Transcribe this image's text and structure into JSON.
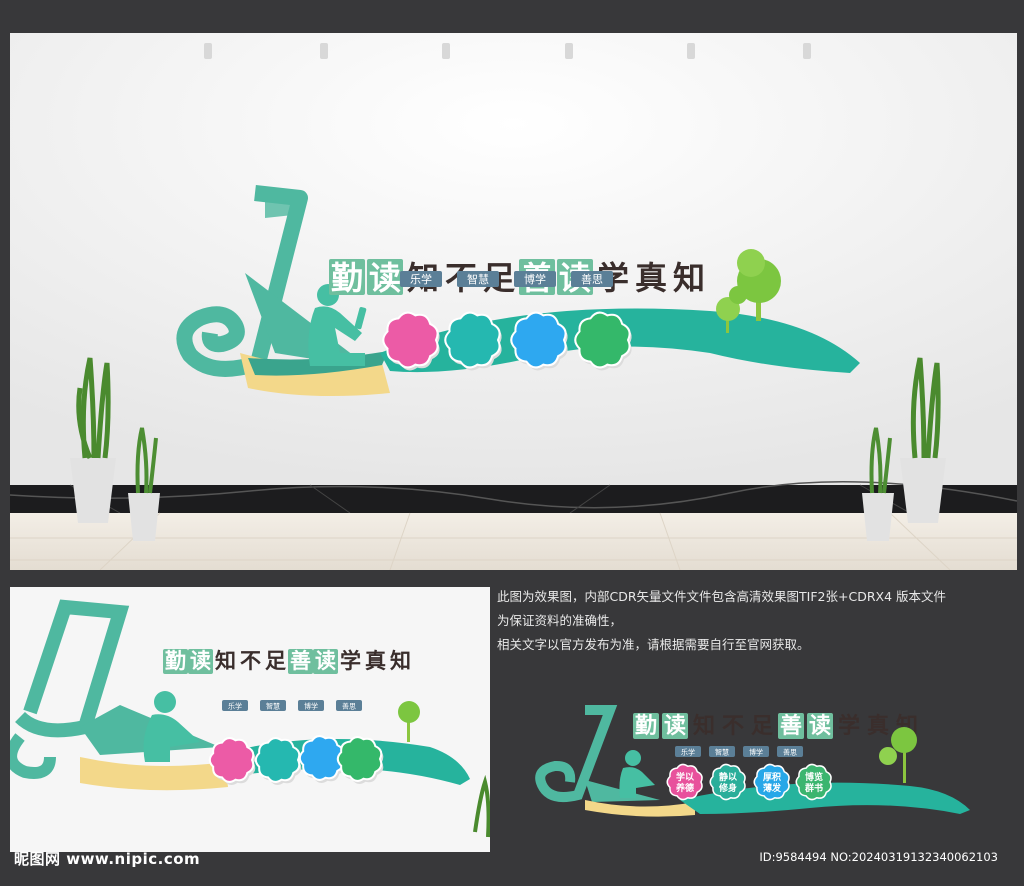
{
  "slogan": {
    "chars": [
      "勤",
      "读",
      "知",
      "不",
      "足",
      "善",
      "读",
      "学",
      "真",
      "知"
    ],
    "boxed": [
      true,
      true,
      false,
      false,
      false,
      true,
      true,
      false,
      false,
      false
    ]
  },
  "tags": [
    "乐学",
    "智慧",
    "博学",
    "善思"
  ],
  "badges": [
    {
      "line1": "学以",
      "line2": "养德",
      "color": "#e8519c"
    },
    {
      "line1": "静以",
      "line2": "修身",
      "color": "#2aae9a"
    },
    {
      "line1": "厚积",
      "line2": "薄发",
      "color": "#27a7e8"
    },
    {
      "line1": "博览",
      "line2": "群书",
      "color": "#3bb56f"
    }
  ],
  "colors": {
    "teal": "#4fb8a0",
    "teal_dark": "#2d9e88",
    "yellow": "#f3d88a",
    "pink": "#ec5ba6",
    "cyan": "#25b8b0",
    "blue": "#2ea8f0",
    "green": "#34b86a",
    "tree": "#7cc640",
    "tag_bg": "#5b7f97",
    "text_dark": "#3a2e2c"
  },
  "description": [
    "此图为效果图，内部CDR矢量文件文件包含高清效果图TIF2张+CDRX4 版本文件",
    "为保证资料的准确性，",
    "相关文字以官方发布为准，请根据需要自行至官网获取。"
  ],
  "watermark": "昵图网 www.nipic.com",
  "image_id": "ID:9584494 NO:20240319132340062103"
}
